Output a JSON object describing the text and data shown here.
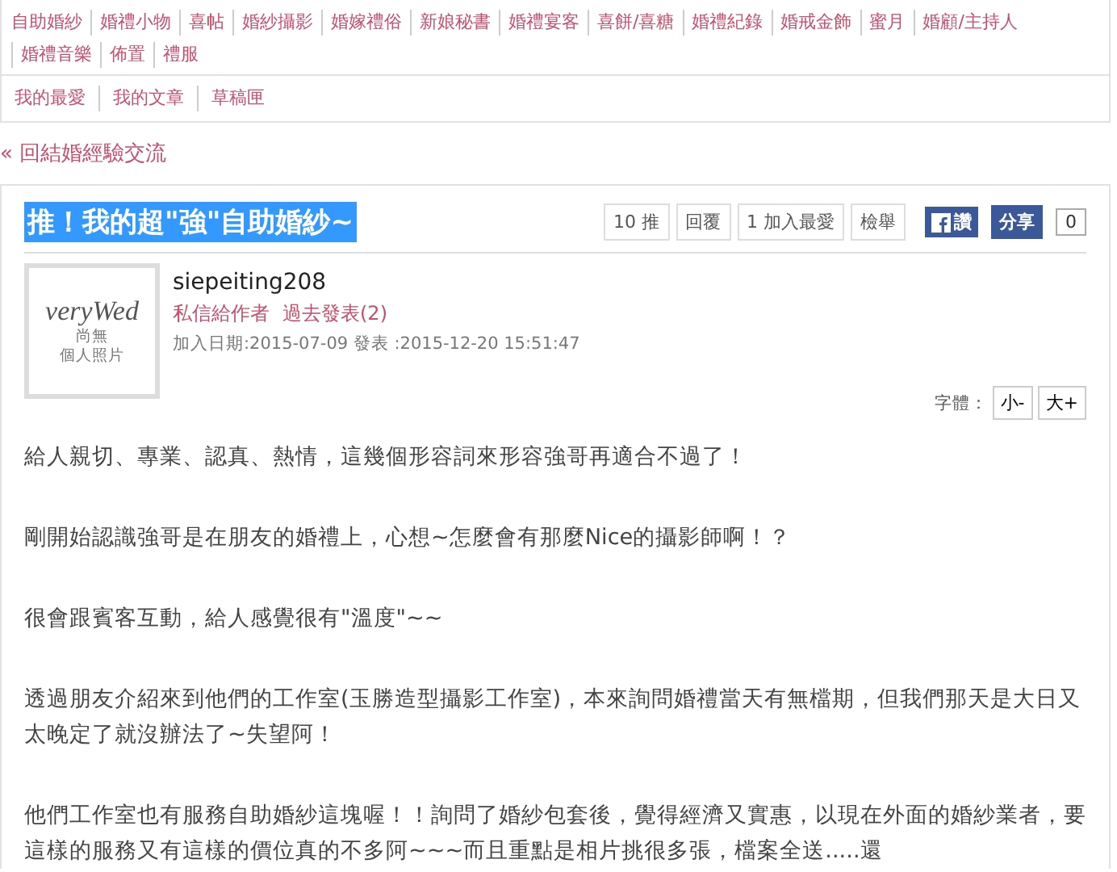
{
  "category_nav": {
    "items": [
      "自助婚紗",
      "婚禮小物",
      "喜帖",
      "婚紗攝影",
      "婚嫁禮俗",
      "新娘秘書",
      "婚禮宴客",
      "喜餅/喜糖",
      "婚禮紀錄",
      "婚戒金飾",
      "蜜月",
      "婚顧/主持人",
      "婚禮音樂",
      "佈置",
      "禮服"
    ]
  },
  "user_nav": {
    "items": [
      "我的最愛",
      "我的文章",
      "草稿匣"
    ]
  },
  "back_link": {
    "icon": "«",
    "label": "回結婚經驗交流"
  },
  "post": {
    "title": "推！我的超\"強\"自助婚紗~",
    "title_selected": true,
    "actions": [
      "10 推",
      "回覆",
      "1 加入最愛",
      "檢舉"
    ],
    "facebook": {
      "like": "讚",
      "share": "分享",
      "count": "0"
    },
    "author": {
      "avatar_logo": "veryWed",
      "avatar_caption": [
        "尚無",
        "個人照片"
      ],
      "name": "siepeiting208",
      "links": [
        "私信給作者",
        "過去發表(2)"
      ],
      "meta": "加入日期:2015-07-09 發表 :2015-12-20 15:51:47"
    },
    "font_size": {
      "label": "字體：",
      "buttons": [
        "小-",
        "大+"
      ]
    },
    "paragraphs": [
      "給人親切、專業、認真、熱情，這幾個形容詞來形容強哥再適合不過了！",
      "剛開始認識強哥是在朋友的婚禮上，心想~怎麼會有那麼Nice的攝影師啊！？",
      "很會跟賓客互動，給人感覺很有\"溫度\"~~",
      "透過朋友介紹來到他們的工作室(玉勝造型攝影工作室)，本來詢問婚禮當天有無檔期，但我們那天是大日又太晚定了就沒辦法了~失望阿！",
      "他們工作室也有服務自助婚紗這塊喔！！詢問了婚紗包套後，覺得經濟又實惠，以現在外面的婚紗業者，要這樣的服務又有這樣的價位真的不多阿~~~而且重點是相片挑很多張，檔案全送.....還"
    ]
  }
}
